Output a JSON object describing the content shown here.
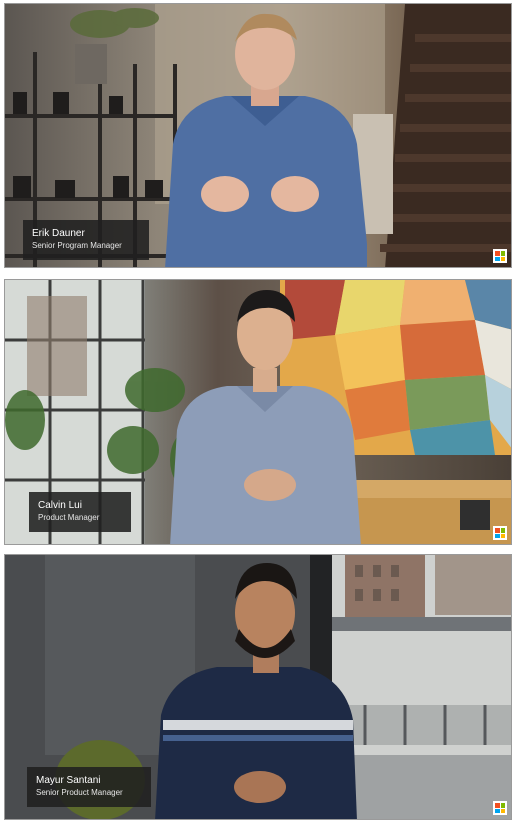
{
  "panels": [
    {
      "name": "Erik Dauner",
      "title": "Senior Program Manager"
    },
    {
      "name": "Calvin Lui",
      "title": "Product Manager"
    },
    {
      "name": "Mayur Santani",
      "title": "Senior Product Manager"
    }
  ],
  "logo_colors": [
    "#f25022",
    "#7fba00",
    "#00a4ef",
    "#ffb900"
  ]
}
